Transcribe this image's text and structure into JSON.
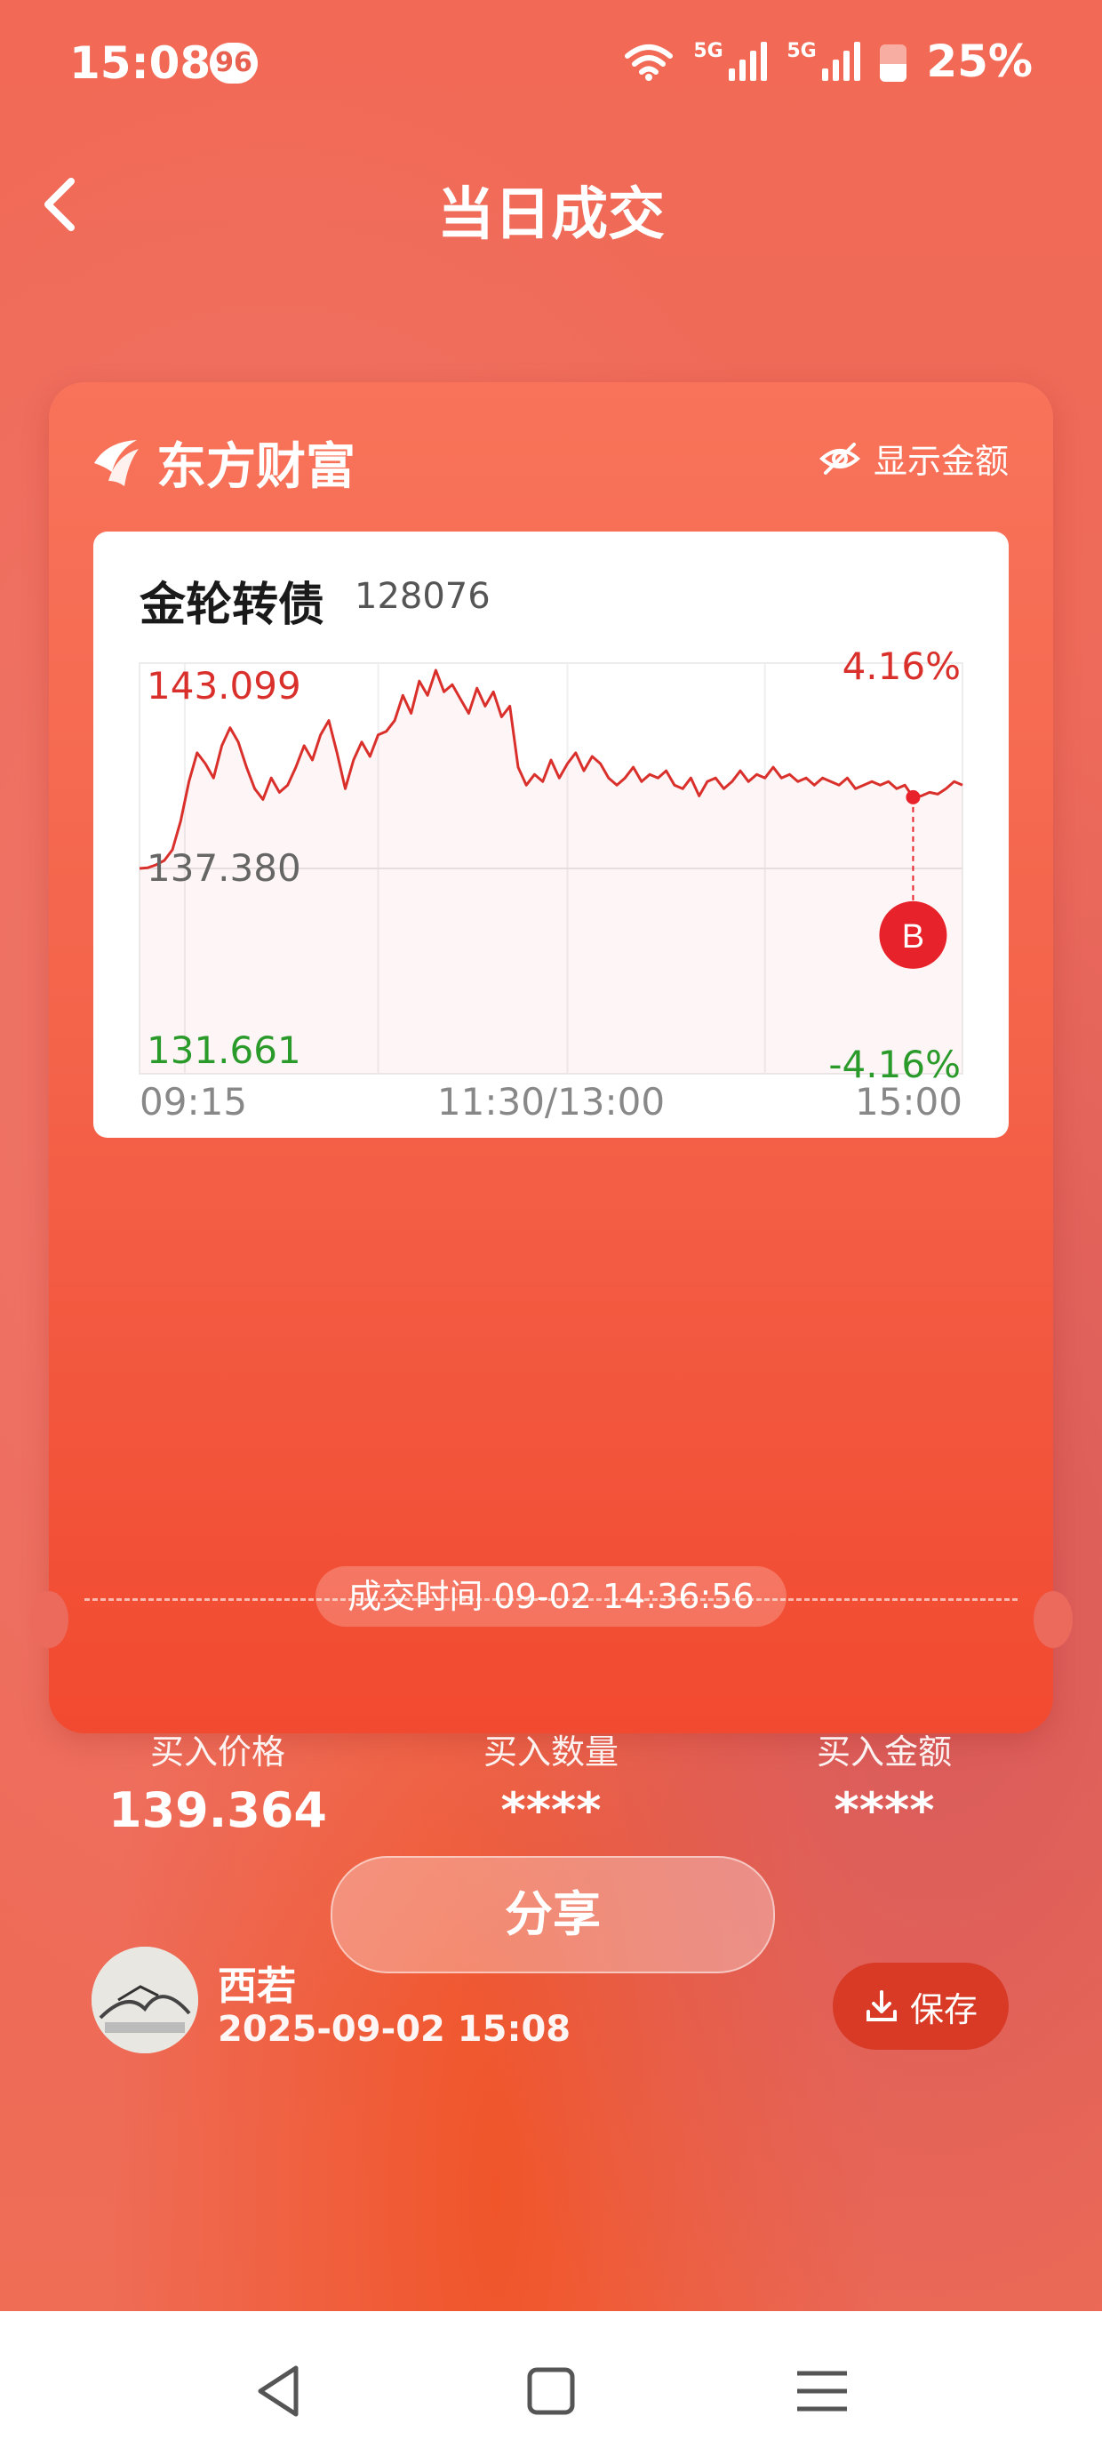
{
  "status_bar": {
    "time": "15:08",
    "badge": "96",
    "network_1": "5G",
    "network_2": "5G",
    "battery": "25%"
  },
  "header": {
    "title": "当日成交"
  },
  "card": {
    "brand": "东方财富",
    "show_amount_label": "显示金额",
    "stock": {
      "name": "金轮转债",
      "code": "128076"
    },
    "trade_time_label": "成交时间 09-02 14:36:56",
    "stats": [
      {
        "label": "买入价格",
        "value": "139.364"
      },
      {
        "label": "买入数量",
        "value": "****"
      },
      {
        "label": "买入金额",
        "value": "****"
      }
    ],
    "user": {
      "name": "西若",
      "datetime": "2025-09-02 15:08"
    },
    "save_label": "保存"
  },
  "chart_data": {
    "type": "line",
    "title": "",
    "y_high_label": "143.099",
    "y_mid_label": "137.380",
    "y_low_label": "131.661",
    "pct_high_label": "4.16%",
    "pct_low_label": "-4.16%",
    "ylim": [
      131.661,
      143.099
    ],
    "x_ticks": [
      "09:15",
      "11:30/13:00",
      "15:00"
    ],
    "marker": {
      "label": "B",
      "time": "14:36",
      "price": 139.364
    },
    "colors": {
      "line": "#d9302c",
      "up": "#d9302c",
      "down": "#2a9a2a",
      "marker": "#e8222a"
    },
    "series": [
      {
        "values": [
          137.38,
          137.4,
          137.48,
          137.6,
          137.9,
          138.7,
          139.8,
          140.6,
          140.3,
          139.9,
          140.8,
          141.3,
          140.9,
          140.2,
          139.6,
          139.3,
          139.9,
          139.5,
          139.7,
          140.2,
          140.8,
          140.4,
          141.1,
          141.5,
          140.6,
          139.6,
          140.4,
          140.9,
          140.5,
          141.1,
          141.2,
          141.5,
          142.2,
          141.7,
          142.6,
          142.2,
          142.9,
          142.3,
          142.5,
          142.1,
          141.7,
          142.4,
          141.9,
          142.3,
          141.6,
          141.9,
          140.2,
          139.7,
          140.0,
          139.8,
          140.4,
          139.9,
          140.3,
          140.6,
          140.1,
          140.5,
          140.3,
          139.9,
          139.7,
          139.9,
          140.2,
          139.8,
          140.0,
          139.9,
          140.1,
          139.7,
          139.6,
          139.9,
          139.4,
          139.8,
          139.9,
          139.6,
          139.8,
          140.1,
          139.8,
          140.0,
          139.9,
          140.2,
          139.9,
          140.0,
          139.8,
          139.9,
          139.7,
          139.9,
          139.8,
          139.7,
          139.9,
          139.6,
          139.7,
          139.8,
          139.7,
          139.8,
          139.6,
          139.7,
          139.364,
          139.4,
          139.5,
          139.45,
          139.6,
          139.8,
          139.7
        ]
      }
    ]
  }
}
